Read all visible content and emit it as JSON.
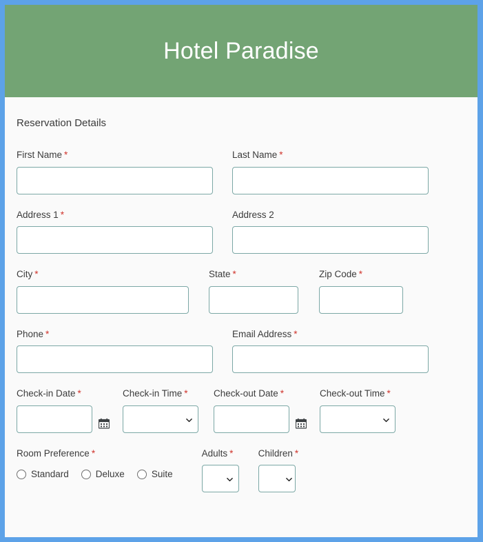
{
  "header": {
    "title": "Hotel Paradise",
    "bg_color": "#73a474",
    "text_color": "#ffffff"
  },
  "page": {
    "border_color": "#5da2e8",
    "body_bg": "#fafafa",
    "required_marker": "*",
    "required_color": "#d0342c",
    "input_border_color": "#7ba7a5"
  },
  "form": {
    "section_title": "Reservation Details",
    "fields": {
      "first_name": {
        "label": "First Name",
        "required": true,
        "value": "",
        "placeholder": ""
      },
      "last_name": {
        "label": "Last Name",
        "required": true,
        "value": "",
        "placeholder": ""
      },
      "address1": {
        "label": "Address 1",
        "required": true,
        "value": "",
        "placeholder": ""
      },
      "address2": {
        "label": "Address 2",
        "required": false,
        "value": "",
        "placeholder": ""
      },
      "city": {
        "label": "City",
        "required": true,
        "value": "",
        "placeholder": ""
      },
      "state": {
        "label": "State",
        "required": true,
        "value": "",
        "placeholder": ""
      },
      "zip": {
        "label": "Zip Code",
        "required": true,
        "value": "",
        "placeholder": ""
      },
      "phone": {
        "label": "Phone",
        "required": true,
        "value": "",
        "placeholder": ""
      },
      "email": {
        "label": "Email Address",
        "required": true,
        "value": "",
        "placeholder": ""
      },
      "checkin_date": {
        "label": "Check-in Date",
        "required": true,
        "value": "",
        "placeholder": "",
        "icon": "calendar-icon"
      },
      "checkin_time": {
        "label": "Check-in Time",
        "required": true,
        "value": "",
        "icon": "chevron-down-icon"
      },
      "checkout_date": {
        "label": "Check-out Date",
        "required": true,
        "value": "",
        "placeholder": "",
        "icon": "calendar-icon"
      },
      "checkout_time": {
        "label": "Check-out Time",
        "required": true,
        "value": "",
        "icon": "chevron-down-icon"
      },
      "room_preference": {
        "label": "Room Preference",
        "required": true,
        "selected": "",
        "options": [
          "Standard",
          "Deluxe",
          "Suite"
        ]
      },
      "adults": {
        "label": "Adults",
        "required": true,
        "value": "",
        "icon": "chevron-down-icon"
      },
      "children": {
        "label": "Children",
        "required": true,
        "value": "",
        "icon": "chevron-down-icon"
      }
    }
  }
}
